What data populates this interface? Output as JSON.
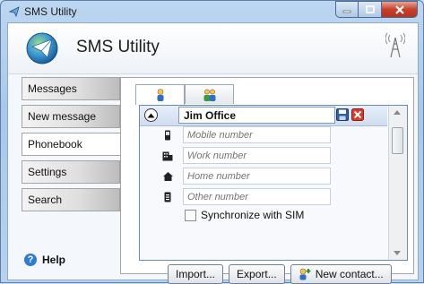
{
  "window": {
    "title": "SMS Utility"
  },
  "header": {
    "app_title": "SMS Utility"
  },
  "nav": {
    "items": [
      {
        "label": "Messages"
      },
      {
        "label": "New message"
      },
      {
        "label": "Phonebook"
      },
      {
        "label": "Settings"
      },
      {
        "label": "Search"
      }
    ],
    "help_label": "Help"
  },
  "contact": {
    "name": "Jim Office",
    "fields": [
      {
        "icon": "mobile-phone-icon",
        "placeholder": "Mobile number"
      },
      {
        "icon": "work-building-icon",
        "placeholder": "Work number"
      },
      {
        "icon": "home-icon",
        "placeholder": "Home number"
      },
      {
        "icon": "other-phone-icon",
        "placeholder": "Other number"
      }
    ],
    "sync_label": "Synchronize with SIM"
  },
  "actions": {
    "import_label": "Import...",
    "export_label": "Export...",
    "new_contact_label": "New contact..."
  },
  "colors": {
    "accent": "#2e7bd4",
    "close_button": "#c6412b",
    "nav_active": "#ffffff"
  }
}
